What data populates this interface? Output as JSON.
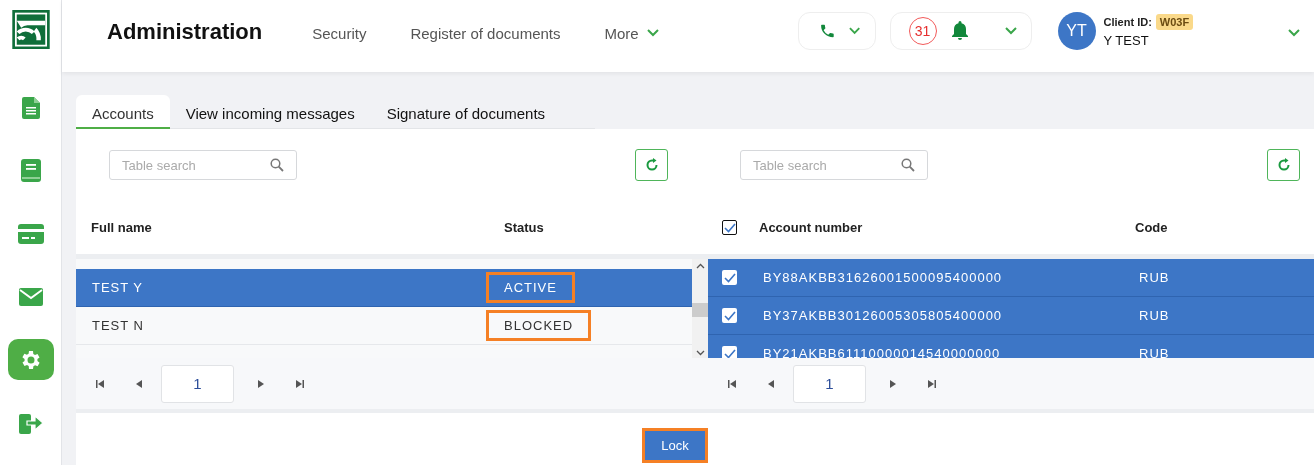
{
  "sidebar": {
    "items": [
      {
        "kind": "document",
        "selected": false
      },
      {
        "kind": "book",
        "selected": false
      },
      {
        "kind": "card",
        "selected": false
      },
      {
        "kind": "mail",
        "selected": false
      },
      {
        "kind": "settings",
        "selected": true
      },
      {
        "kind": "exit",
        "selected": false
      }
    ]
  },
  "header": {
    "title": "Administration",
    "nav": [
      "Security",
      "Register of documents"
    ],
    "more": "More",
    "notifications": "31",
    "user": {
      "initials": "YT",
      "client_id_label": "Client ID:",
      "client_id": "W03F",
      "name": "Y TEST"
    }
  },
  "tabs": [
    {
      "label": "Accounts",
      "selected": true
    },
    {
      "label": "View incoming messages",
      "selected": false
    },
    {
      "label": "Signature of documents",
      "selected": false
    }
  ],
  "left_table": {
    "search_placeholder": "Table search",
    "columns": [
      "Full name",
      "Status"
    ],
    "rows": [
      {
        "full_name": "TEST Y",
        "status": "ACTIVE",
        "selected": true,
        "highlighted": true
      },
      {
        "full_name": "TEST N",
        "status": "BLOCKED",
        "selected": false,
        "highlighted": true
      }
    ],
    "page": "1"
  },
  "right_table": {
    "search_placeholder": "Table search",
    "select_all_checked": true,
    "columns": [
      "Account number",
      "Code"
    ],
    "rows": [
      {
        "account_number": "BY88AKBB31626001500095400000",
        "code": "RUB",
        "selected": true,
        "checked": true
      },
      {
        "account_number": "BY37AKBB30126005305805400000",
        "code": "RUB",
        "selected": true,
        "checked": true
      },
      {
        "account_number": "BY21AKBB61110000014540000000",
        "code": "RUB",
        "selected": true,
        "checked": true
      }
    ],
    "page": "1"
  },
  "lock_button": {
    "label": "Lock",
    "highlighted": true
  }
}
